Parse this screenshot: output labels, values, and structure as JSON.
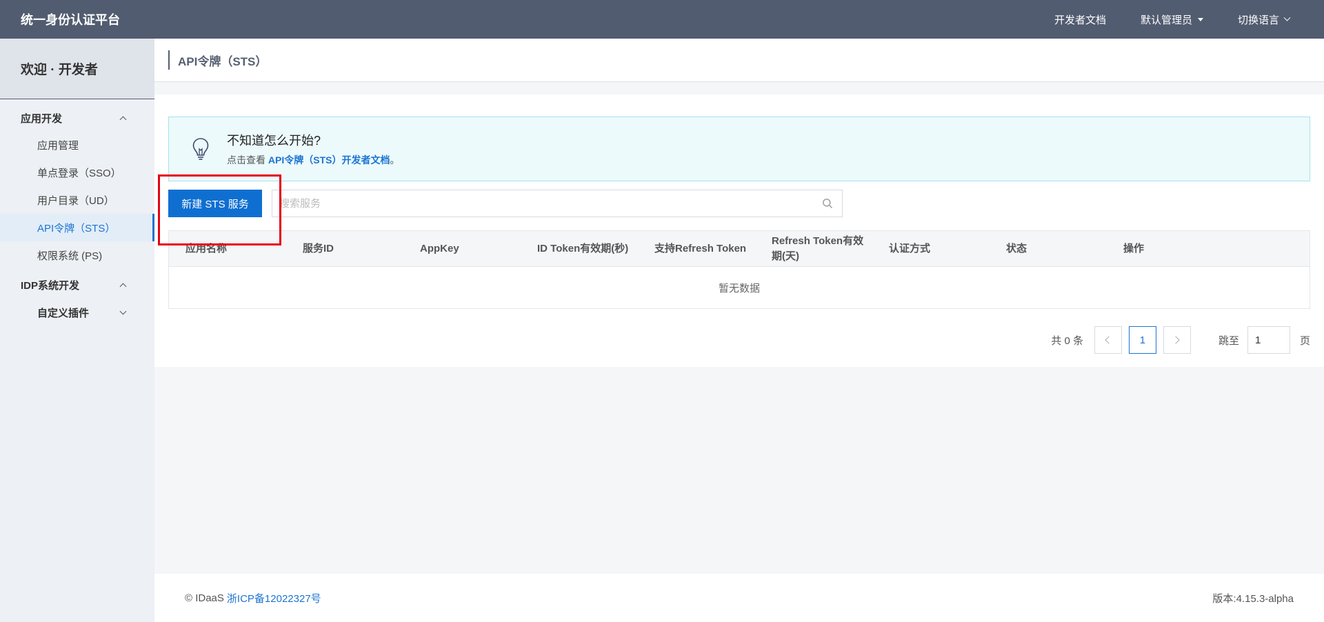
{
  "topbar": {
    "brand": "统一身份认证平台",
    "links": {
      "docs": "开发者文档",
      "admin": "默认管理员",
      "lang": "切换语言"
    }
  },
  "sidebar": {
    "welcome": "欢迎 · 开发者",
    "groups": [
      {
        "label": "应用开发",
        "items": [
          "应用管理",
          "单点登录（SSO）",
          "用户目录（UD）",
          "API令牌（STS）",
          "权限系统 (PS)"
        ]
      },
      {
        "label": "IDP系统开发",
        "sub": "自定义插件"
      }
    ]
  },
  "page": {
    "title": "API令牌（STS）"
  },
  "tip": {
    "title": "不知道怎么开始?",
    "prefix": "点击查看",
    "link": "API令牌（STS）开发者文档",
    "suffix": "。"
  },
  "actions": {
    "new_button": "新建 STS 服务",
    "search_placeholder": "搜索服务"
  },
  "table": {
    "columns": [
      "应用名称",
      "服务ID",
      "AppKey",
      "ID Token有效期(秒)",
      "支持Refresh Token",
      "Refresh Token有效期(天)",
      "认证方式",
      "状态",
      "操作"
    ],
    "empty": "暂无数据"
  },
  "pager": {
    "total": "共 0 条",
    "current": "1",
    "jump_label": "跳至",
    "jump_value": "1",
    "page_unit": "页"
  },
  "footer": {
    "copyright": "© IDaaS",
    "icp": "浙ICP备12022327号",
    "version": "版本:4.15.3-alpha"
  },
  "colors": {
    "topbar": "#525c70",
    "accent": "#1b74d1",
    "button": "#0f6fd1",
    "highlight": "#e60012"
  }
}
